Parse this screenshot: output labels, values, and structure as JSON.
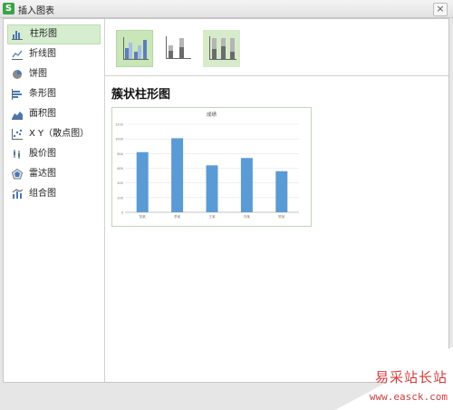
{
  "window": {
    "title": "插入图表",
    "app_icon": "wps-spreadsheet-icon",
    "close_label": "×"
  },
  "sidebar": {
    "items": [
      {
        "label": "柱形图",
        "icon": "column-chart-icon",
        "selected": true
      },
      {
        "label": "折线图",
        "icon": "line-chart-icon",
        "selected": false
      },
      {
        "label": "饼图",
        "icon": "pie-chart-icon",
        "selected": false
      },
      {
        "label": "条形图",
        "icon": "bar-chart-icon",
        "selected": false
      },
      {
        "label": "面积图",
        "icon": "area-chart-icon",
        "selected": false
      },
      {
        "label": "X Y（散点图）",
        "icon": "scatter-chart-icon",
        "selected": false
      },
      {
        "label": "股价图",
        "icon": "stock-chart-icon",
        "selected": false
      },
      {
        "label": "雷达图",
        "icon": "radar-chart-icon",
        "selected": false
      },
      {
        "label": "组合图",
        "icon": "combo-chart-icon",
        "selected": false
      }
    ]
  },
  "subtypes": [
    "clustered-column-icon",
    "stacked-column-icon",
    "percent-stacked-column-icon"
  ],
  "preview": {
    "subtype_title": "簇状柱形图"
  },
  "chart_data": {
    "type": "bar",
    "title": "成绩",
    "categories": [
      "张某",
      "李某",
      "王某",
      "刘某",
      "陈某"
    ],
    "values": [
      820,
      1010,
      640,
      740,
      560
    ],
    "ylim": [
      0,
      1200
    ],
    "yticks": [
      "0",
      "200",
      "400",
      "600",
      "800",
      "1000",
      "1200"
    ],
    "bar_color": "#5b9bd5",
    "grid": true
  },
  "watermark": {
    "text": "易采站长站",
    "url": "www.easck.com",
    "color": "#d63b3b"
  }
}
